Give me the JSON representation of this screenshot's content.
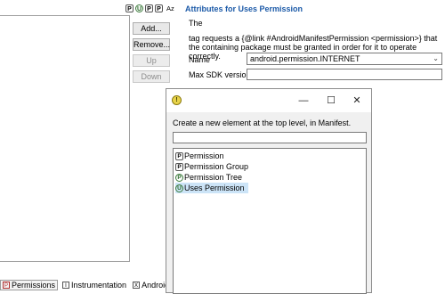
{
  "toolbar": {
    "icons": [
      "P",
      "U",
      "P",
      "P",
      "Az"
    ],
    "icon_names": [
      "permission-icon",
      "uses-permission-icon",
      "permission-icon",
      "permission-icon",
      "sort-alpha-icon"
    ]
  },
  "buttons": {
    "add": "Add...",
    "remove": "Remove...",
    "up": "Up",
    "down": "Down"
  },
  "attributes": {
    "title": "Attributes for Uses Permission",
    "desc_line1": "The",
    "desc_line2": "tag requests a {@link #AndroidManifestPermission <permission>} that the containing package must be granted in order for it to operate correctly.",
    "name_label": "Name",
    "name_value": "android.permission.INTERNET",
    "max_sdk_label": "Max SDK version",
    "max_sdk_value": ""
  },
  "tabs": [
    {
      "label": "Permissions",
      "icon": "P"
    },
    {
      "label": "Instrumentation",
      "icon": "I"
    },
    {
      "label": "AndroidM",
      "icon": "X"
    }
  ],
  "dialog": {
    "icon": "!",
    "minimize": "—",
    "maximize": "☐",
    "close": "✕",
    "message": "Create a new element at the top level, in Manifest.",
    "filter_value": "",
    "items": [
      {
        "label": "Permission",
        "icon": "P"
      },
      {
        "label": "Permission Group",
        "icon": "P"
      },
      {
        "label": "Permission Tree",
        "icon": "P"
      },
      {
        "label": "Uses Permission",
        "icon": "U"
      }
    ],
    "selected_index": 3
  }
}
